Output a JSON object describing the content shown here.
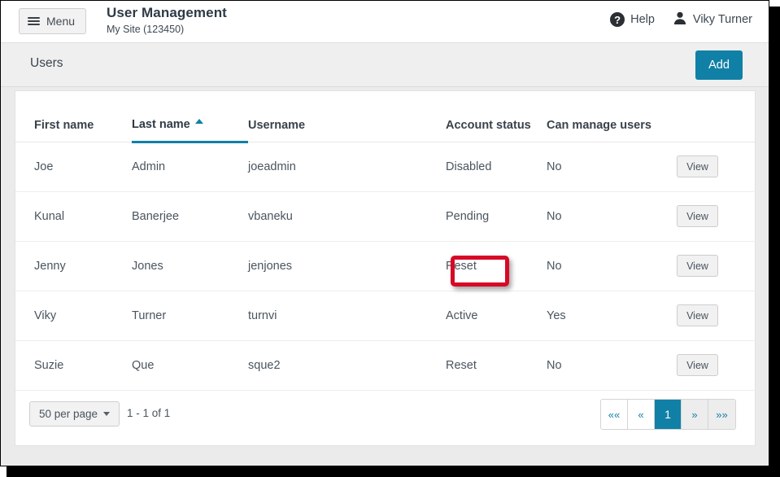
{
  "header": {
    "menu_label": "Menu",
    "menu_icon": "hamburger-icon",
    "title": "User Management",
    "subtitle": "My Site (123450)",
    "help_label": "Help",
    "help_icon": "question-mark-circle-icon",
    "help_glyph": "?",
    "user_label": "Viky Turner",
    "user_icon": "person-icon"
  },
  "subheader": {
    "title": "Users",
    "add_label": "Add"
  },
  "table": {
    "columns": [
      {
        "label": "First name",
        "sorted": false
      },
      {
        "label": "Last name",
        "sorted": true,
        "sort_dir": "asc",
        "sort_icon": "caret-up-icon"
      },
      {
        "label": "Username",
        "sorted": false
      },
      {
        "label": "Account status",
        "sorted": false
      },
      {
        "label": "Can manage users",
        "sorted": false
      },
      {
        "label": "",
        "sorted": false
      }
    ],
    "action_label": "View",
    "rows": [
      {
        "first_name": "Joe",
        "last_name": "Admin",
        "username": "joeadmin",
        "status": "Disabled",
        "can_manage": "No",
        "action": "View"
      },
      {
        "first_name": "Kunal",
        "last_name": "Banerjee",
        "username": "vbaneku",
        "status": "Pending",
        "can_manage": "No",
        "action": "View"
      },
      {
        "first_name": "Jenny",
        "last_name": "Jones",
        "username": "jenjones",
        "status": "Reset",
        "can_manage": "No",
        "action": "View"
      },
      {
        "first_name": "Viky",
        "last_name": "Turner",
        "username": "turnvi",
        "status": "Active",
        "can_manage": "Yes",
        "action": "View"
      },
      {
        "first_name": "Suzie",
        "last_name": "Que",
        "username": "sque2",
        "status": "Reset",
        "can_manage": "No",
        "action": "View"
      }
    ]
  },
  "footer": {
    "per_page_label": "50 per page",
    "per_page_icon": "caret-down-icon",
    "range_text": "1 - 1 of 1",
    "pager": [
      {
        "label": "««",
        "name": "first-page",
        "style": "white"
      },
      {
        "label": "«",
        "name": "prev-page",
        "style": "white"
      },
      {
        "label": "1",
        "name": "page-1",
        "style": "active"
      },
      {
        "label": "»",
        "name": "next-page",
        "style": "grey"
      },
      {
        "label": "»»",
        "name": "last-page",
        "style": "grey"
      }
    ]
  },
  "annotation": {
    "target": "Reset",
    "color": "#d70926"
  },
  "colors": {
    "accent": "#1180a6",
    "page_background": "#ebebeb",
    "card_background": "#ffffff",
    "subbar_background": "#efefef",
    "text": "#4a545e",
    "highlight": "#d70926"
  }
}
